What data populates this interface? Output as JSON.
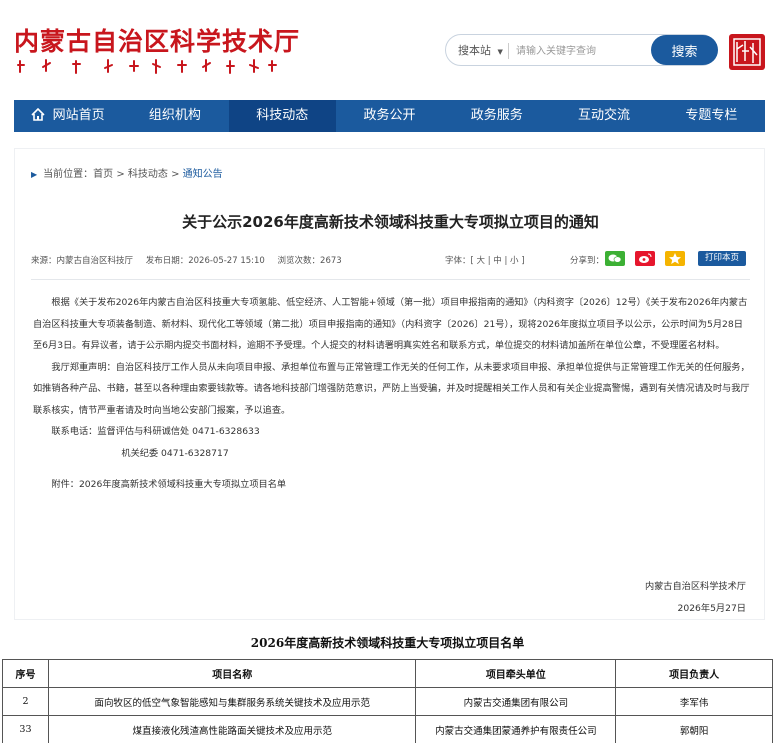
{
  "header": {
    "logo_cn": "内蒙古自治区科学技术厅",
    "search_scope": "搜本站",
    "search_placeholder": "请输入关键字查询",
    "search_button": "搜索"
  },
  "nav": {
    "items": [
      {
        "label": "网站首页",
        "active": false
      },
      {
        "label": "组织机构",
        "active": false
      },
      {
        "label": "科技动态",
        "active": true
      },
      {
        "label": "政务公开",
        "active": false
      },
      {
        "label": "政务服务",
        "active": false
      },
      {
        "label": "互动交流",
        "active": false
      },
      {
        "label": "专题专栏",
        "active": false
      }
    ]
  },
  "breadcrumb": {
    "prefix": "当前位置：",
    "home": "首页",
    "sep1": " > ",
    "section": "科技动态",
    "sep2": " > ",
    "current": "通知公告"
  },
  "article": {
    "title": "关于公示2026年度高新技术领域科技重大专项拟立项目的通知",
    "source": "来源：内蒙古自治区科技厅",
    "date": "发布日期：2026-05-27 15:10",
    "views": "浏览次数：2673",
    "font_ctl": "字体：[ 大 | 中 | 小 ]",
    "share_label": "分享到：",
    "print_label": "打印本页",
    "para1": "根据《关于发布2026年内蒙古自治区科技重大专项氢能、低空经济、人工智能+领域（第一批）项目申报指南的通知》（内科资字〔2026〕12号）《关于发布2026年内蒙古自治区科技重大专项装备制造、新材料、现代化工等领域（第二批）项目申报指南的通知》（内科资字〔2026〕21号），现将2026年度拟立项目予以公示，公示时间为5月28日至6月3日。有异议者，请于公示期内提交书面材料，逾期不予受理。个人提交的材料请署明真实姓名和联系方式，单位提交的材料请加盖所在单位公章，不受理匿名材料。",
    "para2": "我厅郑重声明：自治区科技厅工作人员从未向项目申报、承担单位布置与正常管理工作无关的任何工作，从未要求项目申报、承担单位提供与正常管理工作无关的任何服务，如推销各种产品、书籍，甚至以各种理由索要钱款等。请各地科技部门增强防范意识，严防上当受骗，并及时提醒相关工作人员和有关企业提高警惕，遇到有关情况请及时与我厅联系核实，情节严重者请及时向当地公安部门报案，予以追查。",
    "contact1": "联系电话：监督评估与科研诚信处 0471-6328633",
    "contact2": "机关纪委  0471-6328717",
    "attachment": "附件：2026年度高新技术领域科技重大专项拟立项目名单",
    "sign_org": "内蒙古自治区科学技术厅",
    "sign_date": "2026年5月27日"
  },
  "project_list": {
    "title": "2026年度高新技术领域科技重大专项拟立项目名单",
    "headers": [
      "序号",
      "项目名称",
      "项目牵头单位",
      "项目负责人"
    ],
    "rows": [
      [
        "2",
        "面向牧区的低空气象智能感知与集群服务系统关键技术及应用示范",
        "内蒙古交通集团有限公司",
        "李军伟"
      ],
      [
        "33",
        "煤直接液化残渣高性能路面关键技术及应用示范",
        "内蒙古交通集团蒙通养护有限责任公司",
        "郭朝阳"
      ]
    ]
  },
  "colors": {
    "brand_red": "#c8161d",
    "nav_blue": "#1b5a9e",
    "nav_active": "#0f4485",
    "wechat_green": "#3cb034",
    "weibo_red": "#e6162d",
    "qzone_yellow": "#f5b400"
  },
  "icons": [
    "home-icon",
    "breadcrumb-arrow-icon",
    "dropdown-caret-icon",
    "wechat-icon",
    "weibo-icon",
    "qzone-icon"
  ]
}
